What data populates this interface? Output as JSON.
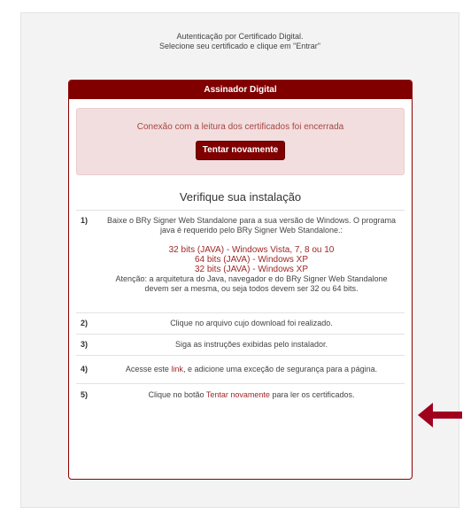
{
  "intro": {
    "line1": "Autenticação por Certificado Digital.",
    "line2": "Selecione seu certificado e clique em \"Entrar\""
  },
  "card": {
    "title": "Assinador Digital",
    "alert": {
      "message": "Conexão com a leitura dos certificados foi encerrada",
      "retry_label": "Tentar novamente"
    },
    "verify_title": "Verifique sua instalação",
    "steps": [
      {
        "num": "1)",
        "text": "Baixe o BRy Signer Web Standalone para a sua versão de Windows. O programa java é requerido pelo BRy Signer Web Standalone.:",
        "links": [
          "32 bits (JAVA) - Windows Vista, 7, 8 ou 10",
          "64 bits (JAVA) - Windows XP",
          "32 bits (JAVA) - Windows XP"
        ],
        "note": "Atenção: a arquitetura do Java, navegador e do BRy Signer Web Standalone devem ser a mesma, ou seja todos devem ser 32 ou 64 bits."
      },
      {
        "num": "2)",
        "text": "Clique no arquivo cujo download foi realizado."
      },
      {
        "num": "3)",
        "text": "Siga as instruções exibidas pelo instalador."
      },
      {
        "num": "4)",
        "text_before": "Acesse este ",
        "link": "link",
        "text_after": ", e adicione uma exceção de segurança para a página."
      },
      {
        "num": "5)",
        "text_before": "Clique no botão ",
        "link": "Tentar novamente",
        "text_after": " para ler os certificados."
      }
    ]
  },
  "colors": {
    "brand": "#800000",
    "link": "#a02828",
    "alert_bg": "#f2dede",
    "arrow": "#a0001e"
  },
  "annotation": {
    "icon": "arrow-left-icon"
  }
}
